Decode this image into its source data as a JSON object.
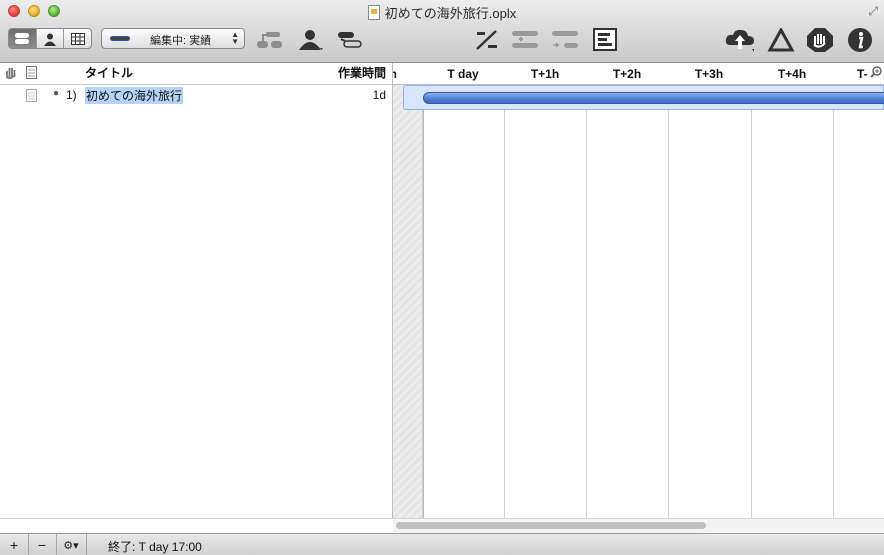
{
  "window": {
    "title": "初めての海外旅行.oplx"
  },
  "toolbar": {
    "style_popup_value": "編集中: 実績"
  },
  "outline": {
    "columns": {
      "title": "タイトル",
      "effort": "作業時間"
    },
    "rows": [
      {
        "number": "1)",
        "title": "初めての海外旅行",
        "effort": "1d"
      }
    ]
  },
  "gantt": {
    "partial_left": "n",
    "columns": [
      "T day",
      "T+1h",
      "T+2h",
      "T+3h",
      "T+4h",
      "T-"
    ]
  },
  "statusbar": {
    "text": "終了: T day 17:00"
  },
  "colors": {
    "accent_bar": "#4b7fd2",
    "selection": "#b4d3f7"
  }
}
